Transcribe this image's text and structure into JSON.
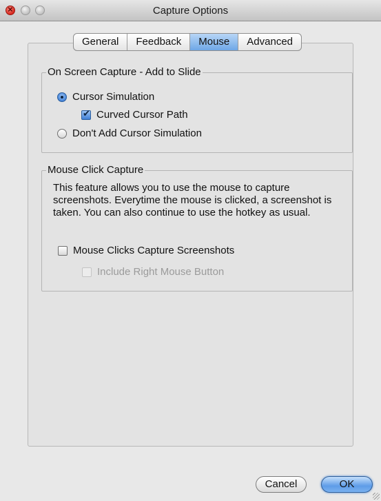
{
  "window": {
    "title": "Capture Options"
  },
  "tabs": [
    {
      "label": "General",
      "active": false
    },
    {
      "label": "Feedback",
      "active": false
    },
    {
      "label": "Mouse",
      "active": true
    },
    {
      "label": "Advanced",
      "active": false
    }
  ],
  "on_screen_capture": {
    "group_label": "On Screen Capture - Add to Slide",
    "cursor_simulation_label": "Cursor Simulation",
    "cursor_simulation_selected": true,
    "curved_cursor_path_label": "Curved Cursor Path",
    "curved_cursor_path_checked": true,
    "dont_add_label": "Don't Add Cursor Simulation",
    "dont_add_selected": false
  },
  "mouse_click_capture": {
    "group_label": "Mouse Click Capture",
    "description": "This feature allows you to use the mouse to capture screenshots. Everytime the mouse is clicked, a screenshot is taken. You can also continue to use the hotkey as usual.",
    "mouse_clicks_label": "Mouse Clicks Capture Screenshots",
    "mouse_clicks_checked": false,
    "include_right_label": "Include Right Mouse Button",
    "include_right_checked": false,
    "include_right_enabled": false
  },
  "buttons": {
    "cancel_label": "Cancel",
    "ok_label": "OK"
  },
  "colors": {
    "accent": "#6ea7e6",
    "window_bg": "#e8e8e8"
  }
}
